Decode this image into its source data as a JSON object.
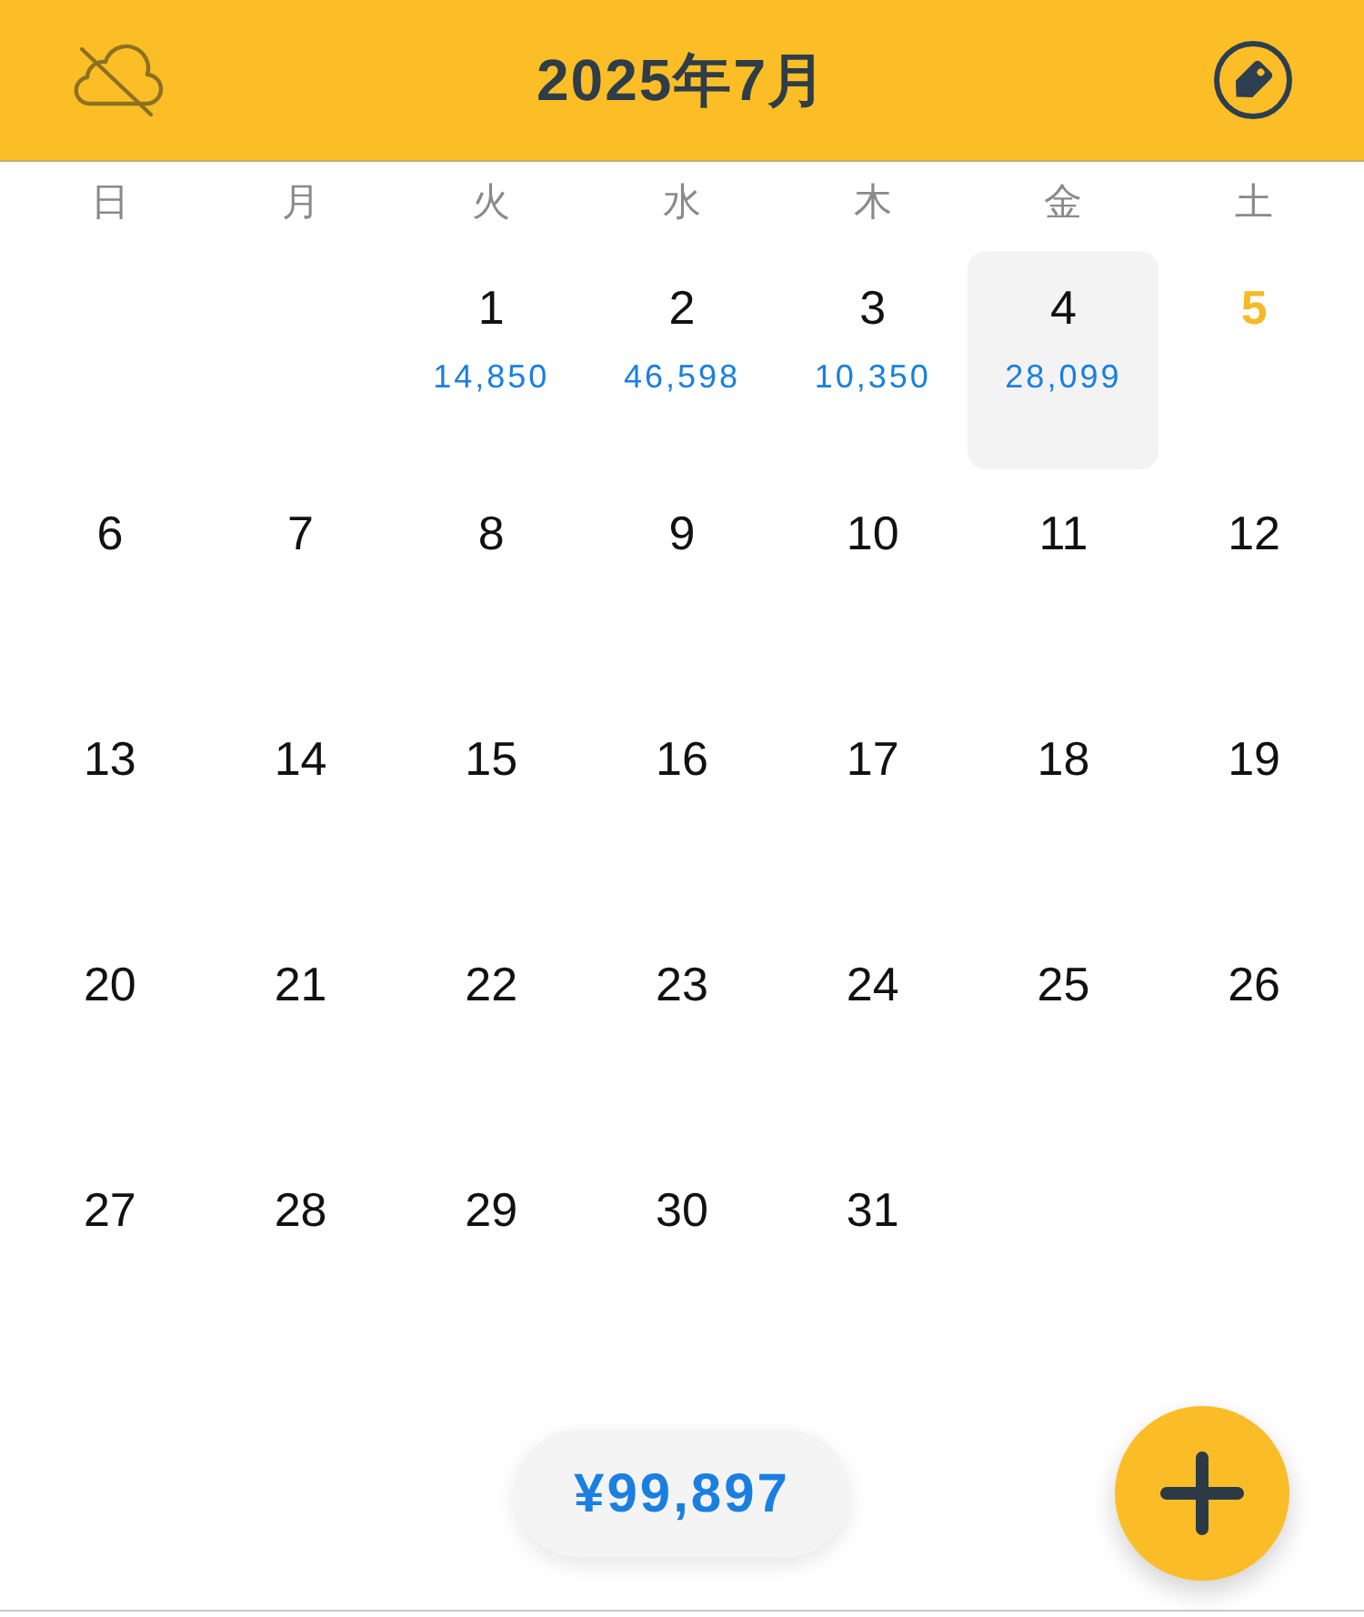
{
  "header": {
    "title": "2025年7月"
  },
  "weekdays": [
    "日",
    "月",
    "火",
    "水",
    "木",
    "金",
    "土"
  ],
  "weeks": [
    [
      {
        "kind": "blank"
      },
      {
        "kind": "blank"
      },
      {
        "kind": "day",
        "day": "1",
        "amount": "14,850",
        "selected": false,
        "today": false
      },
      {
        "kind": "day",
        "day": "2",
        "amount": "46,598",
        "selected": false,
        "today": false
      },
      {
        "kind": "day",
        "day": "3",
        "amount": "10,350",
        "selected": false,
        "today": false
      },
      {
        "kind": "day",
        "day": "4",
        "amount": "28,099",
        "selected": true,
        "today": false
      },
      {
        "kind": "day",
        "day": "5",
        "selected": false,
        "today": true
      }
    ],
    [
      {
        "kind": "day",
        "day": "6",
        "selected": false,
        "today": false
      },
      {
        "kind": "day",
        "day": "7",
        "selected": false,
        "today": false
      },
      {
        "kind": "day",
        "day": "8",
        "selected": false,
        "today": false
      },
      {
        "kind": "day",
        "day": "9",
        "selected": false,
        "today": false
      },
      {
        "kind": "day",
        "day": "10",
        "selected": false,
        "today": false
      },
      {
        "kind": "day",
        "day": "11",
        "selected": false,
        "today": false
      },
      {
        "kind": "day",
        "day": "12",
        "selected": false,
        "today": false
      }
    ],
    [
      {
        "kind": "day",
        "day": "13",
        "selected": false,
        "today": false
      },
      {
        "kind": "day",
        "day": "14",
        "selected": false,
        "today": false
      },
      {
        "kind": "day",
        "day": "15",
        "selected": false,
        "today": false
      },
      {
        "kind": "day",
        "day": "16",
        "selected": false,
        "today": false
      },
      {
        "kind": "day",
        "day": "17",
        "selected": false,
        "today": false
      },
      {
        "kind": "day",
        "day": "18",
        "selected": false,
        "today": false
      },
      {
        "kind": "day",
        "day": "19",
        "selected": false,
        "today": false
      }
    ],
    [
      {
        "kind": "day",
        "day": "20",
        "selected": false,
        "today": false
      },
      {
        "kind": "day",
        "day": "21",
        "selected": false,
        "today": false
      },
      {
        "kind": "day",
        "day": "22",
        "selected": false,
        "today": false
      },
      {
        "kind": "day",
        "day": "23",
        "selected": false,
        "today": false
      },
      {
        "kind": "day",
        "day": "24",
        "selected": false,
        "today": false
      },
      {
        "kind": "day",
        "day": "25",
        "selected": false,
        "today": false
      },
      {
        "kind": "day",
        "day": "26",
        "selected": false,
        "today": false
      }
    ],
    [
      {
        "kind": "day",
        "day": "27",
        "selected": false,
        "today": false
      },
      {
        "kind": "day",
        "day": "28",
        "selected": false,
        "today": false
      },
      {
        "kind": "day",
        "day": "29",
        "selected": false,
        "today": false
      },
      {
        "kind": "day",
        "day": "30",
        "selected": false,
        "today": false
      },
      {
        "kind": "day",
        "day": "31",
        "selected": false,
        "today": false
      },
      {
        "kind": "blank"
      },
      {
        "kind": "blank"
      }
    ]
  ],
  "total": "¥99,897"
}
